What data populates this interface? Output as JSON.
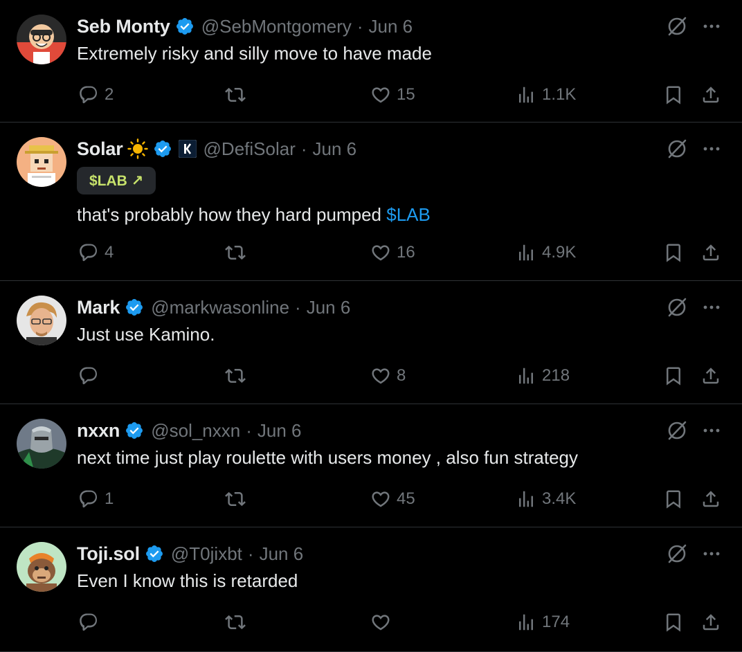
{
  "tweets": [
    {
      "name": "Seb Monty",
      "handle": "@SebMontgomery",
      "sep": "·",
      "date": "Jun 6",
      "text": "Extremely risky and silly move to have made",
      "replies": "2",
      "retweets": "",
      "likes": "15",
      "views": "1.1K",
      "avatar_color": "#3a3a3a"
    },
    {
      "name": "Solar",
      "handle": "@DefiSolar",
      "sep": "·",
      "date": "Jun 6",
      "cashtag_pill": "$LAB ↗",
      "text": "that's probably how they hard pumped ",
      "text_link": "$LAB",
      "replies": "4",
      "retweets": "",
      "likes": "16",
      "views": "4.9K",
      "avatar_color": "#f4b183"
    },
    {
      "name": "Mark",
      "handle": "@markwasonline",
      "sep": "·",
      "date": "Jun 6",
      "text": "Just use Kamino.",
      "replies": "",
      "retweets": "",
      "likes": "8",
      "views": "218",
      "avatar_color": "#d9d9d9"
    },
    {
      "name": "nxxn",
      "handle": "@sol_nxxn",
      "sep": "·",
      "date": "Jun 6",
      "text": "next time just play roulette with users money , also fun strategy",
      "replies": "1",
      "retweets": "",
      "likes": "45",
      "views": "3.4K",
      "avatar_color": "#2e4a3a"
    },
    {
      "name": "Toji.sol",
      "handle": "@T0jixbt",
      "sep": "·",
      "date": "Jun 6",
      "text": "Even I know this is retarded",
      "replies": "",
      "retweets": "",
      "likes": "",
      "views": "174",
      "avatar_color": "#bfe5c4"
    }
  ],
  "colors": {
    "background": "#000000",
    "text": "#e7e9ea",
    "muted": "#71767b",
    "accent": "#1d9bf0",
    "cashtag_text": "#c7e26b",
    "cashtag_bg": "#25282c",
    "divider": "#2f3336"
  },
  "icons": {
    "verified": "verified-badge-icon",
    "grok": "grok-icon",
    "more": "more-horizontal-icon",
    "reply": "reply-icon",
    "retweet": "retweet-icon",
    "like": "heart-icon",
    "views": "views-icon",
    "bookmark": "bookmark-icon",
    "share": "share-icon"
  }
}
